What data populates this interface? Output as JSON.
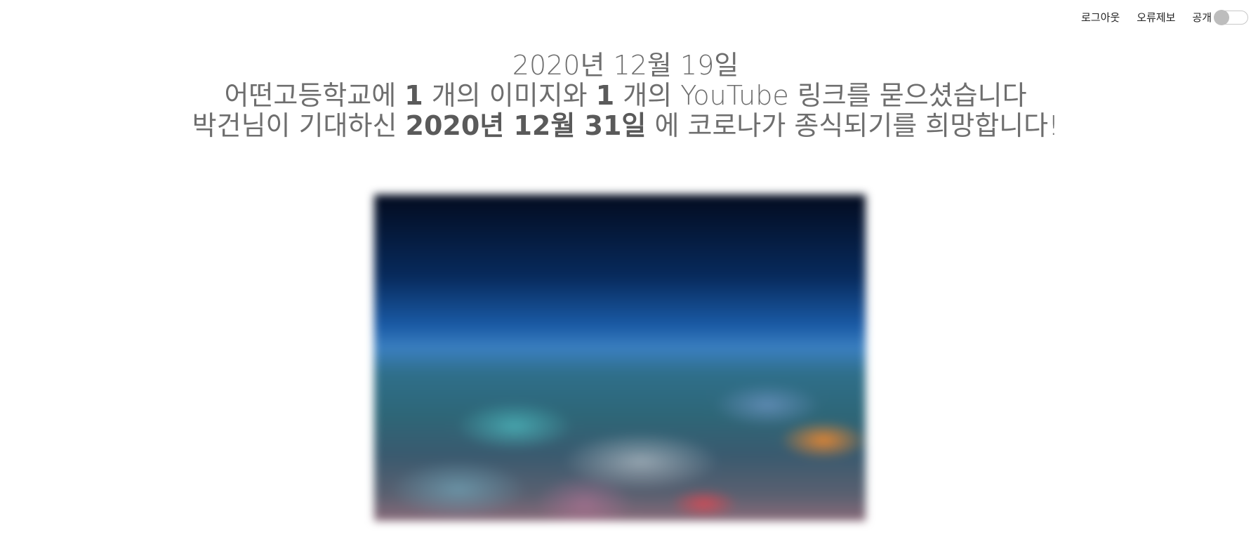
{
  "nav": {
    "logout_label": "로그아웃",
    "report_label": "오류제보",
    "public_label": "공개",
    "public_toggle_on": false
  },
  "headline": {
    "date": "2020년 12월 19일",
    "line2_prefix": "어떤고등학교에 ",
    "image_count": "1",
    "line2_middle": " 개의 이미지와 ",
    "link_count": "1",
    "line2_suffix": " 개의 YouTube 링크를 묻으셨습니다",
    "line3_prefix": "박건님이 기대하신 ",
    "target_date": "2020년 12월 31일",
    "line3_suffix": " 에 코로나가 종식되기를 희망합니다!"
  },
  "colors": {
    "text": "#6e6e6e",
    "toggle_knob": "#bdbdbd",
    "toggle_border": "#c8c8c8"
  }
}
